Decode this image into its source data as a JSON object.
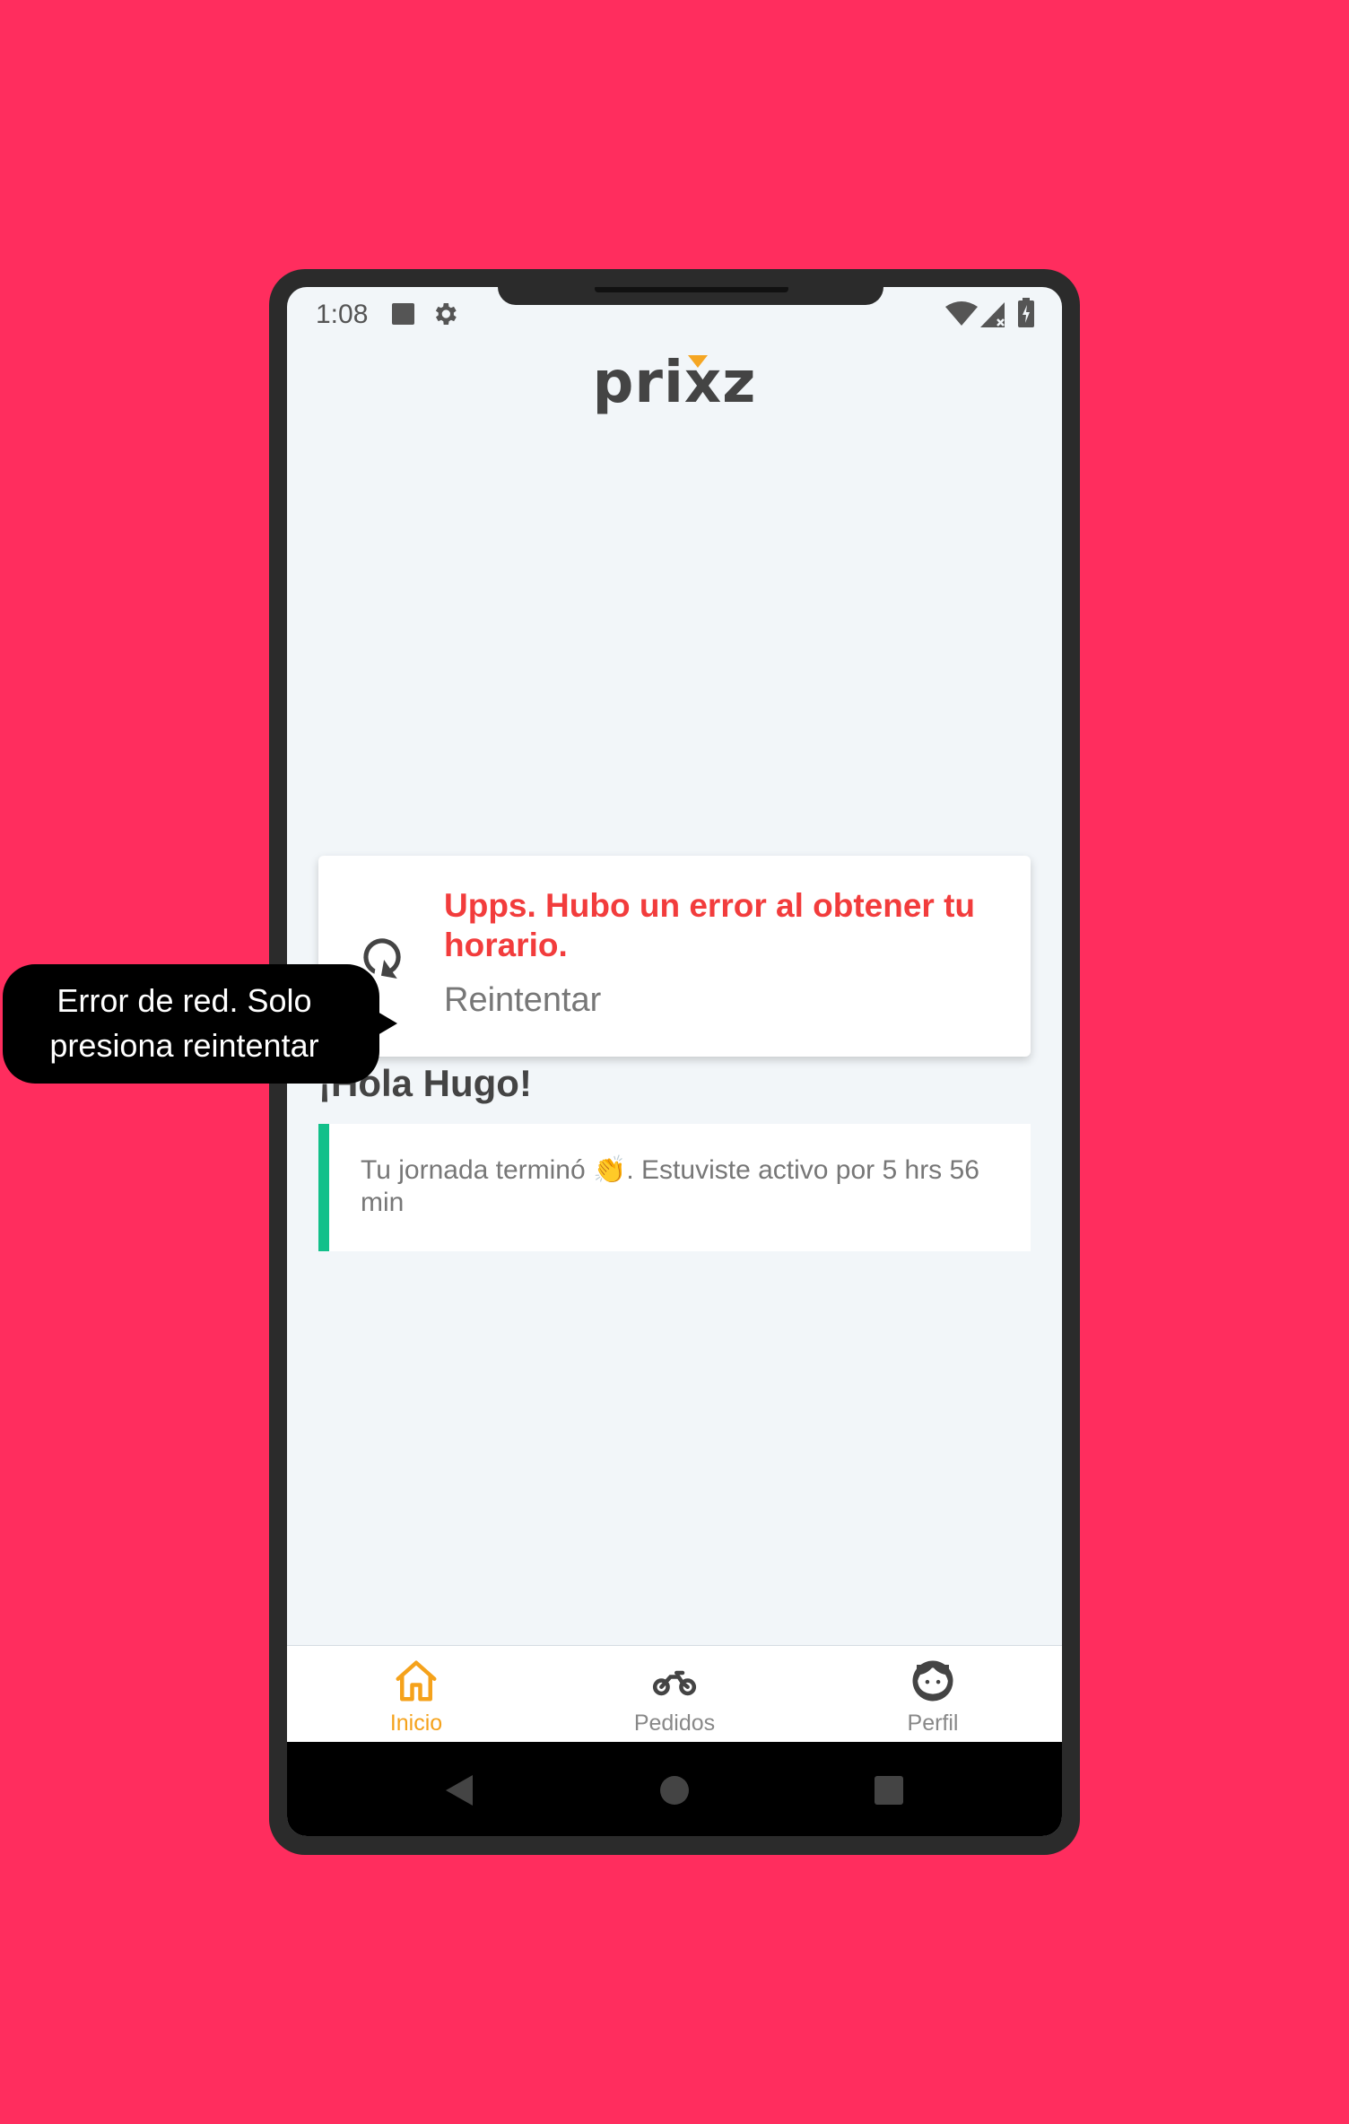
{
  "status_bar": {
    "time": "1:08"
  },
  "header": {
    "logo": "prixz"
  },
  "greeting": "¡Hola Hugo!",
  "error_card": {
    "title": "Upps. Hubo un error al obtener tu horario.",
    "retry_label": "Reintentar",
    "icon": "refresh-icon"
  },
  "info_card": {
    "text": "Tu jornada terminó 👏. Estuviste activo por 5 hrs 56 min",
    "accent_color": "#12c08a"
  },
  "tabs": [
    {
      "label": "Inicio",
      "icon": "home-icon",
      "active": true
    },
    {
      "label": "Pedidos",
      "icon": "motorcycle-icon",
      "active": false
    },
    {
      "label": "Perfil",
      "icon": "profile-face-icon",
      "active": false
    }
  ],
  "tooltip": {
    "text": "Error de red. Solo presiona reintentar"
  },
  "colors": {
    "background": "#ff2d5e",
    "error": "#f23c3c",
    "active_tab": "#f5a21b",
    "accent": "#12c08a"
  }
}
